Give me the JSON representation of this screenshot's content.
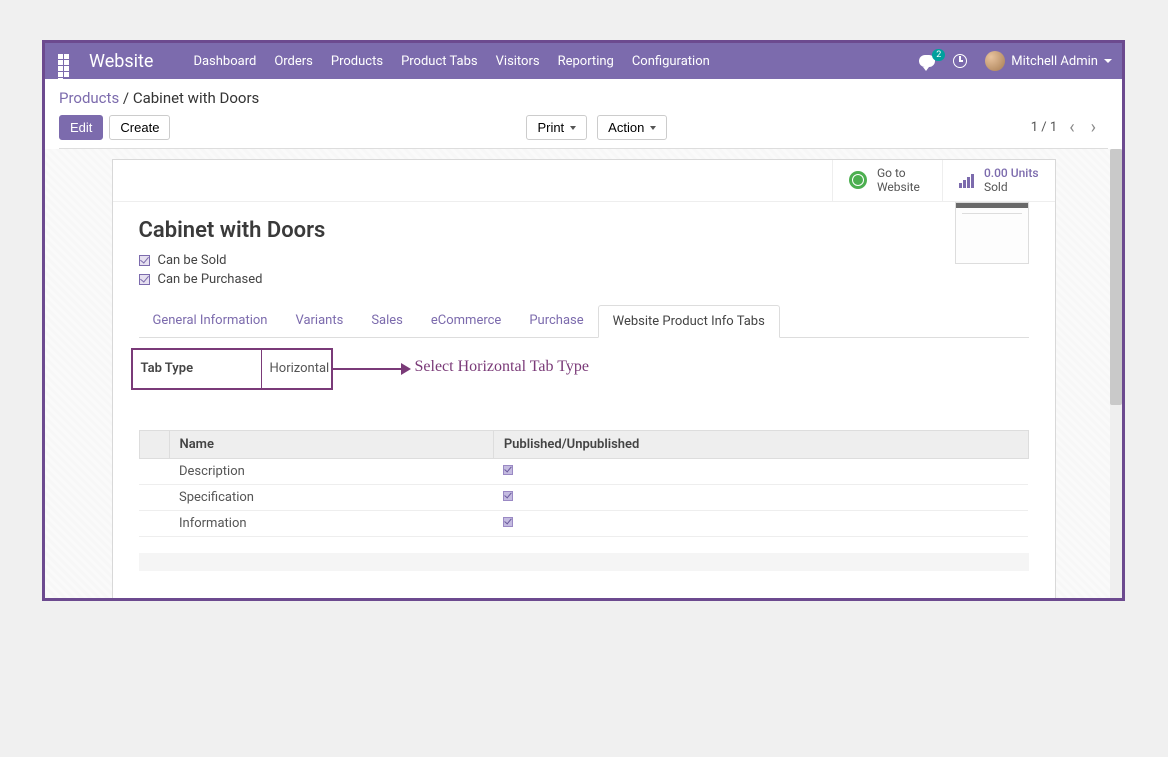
{
  "nav": {
    "brand": "Website",
    "items": [
      "Dashboard",
      "Orders",
      "Products",
      "Product Tabs",
      "Visitors",
      "Reporting",
      "Configuration"
    ],
    "msg_count": "2",
    "user_name": "Mitchell Admin"
  },
  "breadcrumb": {
    "parent": "Products",
    "sep": " / ",
    "current": "Cabinet with Doors"
  },
  "buttons": {
    "edit": "Edit",
    "create": "Create",
    "print": "Print",
    "action": "Action"
  },
  "pager": {
    "text": "1 / 1"
  },
  "stats": {
    "goto_l1": "Go to",
    "goto_l2": "Website",
    "units_val": "0.00 Units",
    "units_lbl": "Sold"
  },
  "product": {
    "title": "Cabinet with Doors",
    "can_be_sold": "Can be Sold",
    "can_be_purchased": "Can be Purchased"
  },
  "tabs": {
    "items": [
      "General Information",
      "Variants",
      "Sales",
      "eCommerce",
      "Purchase",
      "Website Product Info Tabs"
    ],
    "active_index": 5
  },
  "tabtype": {
    "label": "Tab Type",
    "value": "Horizontal"
  },
  "annotation": "Select Horizontal Tab Type",
  "table": {
    "col_name": "Name",
    "col_pub": "Published/Unpublished",
    "rows": [
      {
        "name": "Description",
        "published": true
      },
      {
        "name": "Specification",
        "published": true
      },
      {
        "name": "Information",
        "published": true
      }
    ]
  }
}
